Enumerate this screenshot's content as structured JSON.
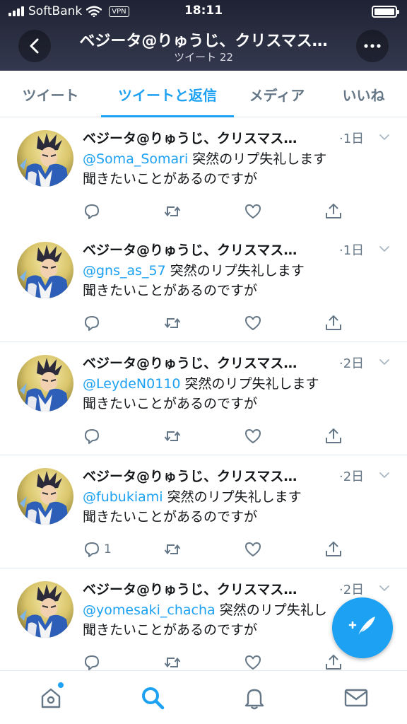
{
  "status_bar": {
    "carrier": "SoftBank",
    "vpn": "VPN",
    "time": "18:11"
  },
  "header": {
    "title": "ベジータ@りゅうじ、クリスマス…",
    "subtitle": "ツイート 22"
  },
  "tabs": [
    {
      "label": "ツイート",
      "active": false
    },
    {
      "label": "ツイートと返信",
      "active": true
    },
    {
      "label": "メディア",
      "active": false
    },
    {
      "label": "いいね",
      "active": false
    }
  ],
  "tweets": [
    {
      "name": "ベジータ@りゅうじ、クリスマス…",
      "time": "·1日",
      "mention": "@Soma_Somari",
      "text1": " 突然のリプ失礼します",
      "text2": "聞きたいことがあるのですが",
      "reply_count": ""
    },
    {
      "name": "ベジータ@りゅうじ、クリスマス…",
      "time": "·1日",
      "mention": "@gns_as_57",
      "text1": " 突然のリプ失礼します",
      "text2": "聞きたいことがあるのですが",
      "reply_count": ""
    },
    {
      "name": "ベジータ@りゅうじ、クリスマス…",
      "time": "·2日",
      "mention": "@LeydeN0110",
      "text1": " 突然のリプ失礼します",
      "text2": "聞きたいことがあるのですが",
      "reply_count": ""
    },
    {
      "name": "ベジータ@りゅうじ、クリスマス…",
      "time": "·2日",
      "mention": "@fubukiami",
      "text1": " 突然のリプ失礼します",
      "text2": "聞きたいことがあるのですが",
      "reply_count": "1"
    },
    {
      "name": "ベジータ@りゅうじ、クリスマス…",
      "time": "·2日",
      "mention": "@yomesaki_chacha",
      "text1": " 突然のリプ失礼し",
      "text2": "聞きたいことがあるのですが",
      "reply_count": ""
    }
  ],
  "icons": {
    "back": "chevron-left-icon",
    "more": "more-icon",
    "reply": "reply-icon",
    "retweet": "retweet-icon",
    "like": "heart-icon",
    "share": "share-icon",
    "compose": "compose-icon",
    "home": "home-icon",
    "search": "search-icon",
    "notifications": "bell-icon",
    "messages": "mail-icon"
  },
  "colors": {
    "accent": "#1da1f2",
    "muted": "#657786",
    "header_bg": "#2b2f42"
  }
}
